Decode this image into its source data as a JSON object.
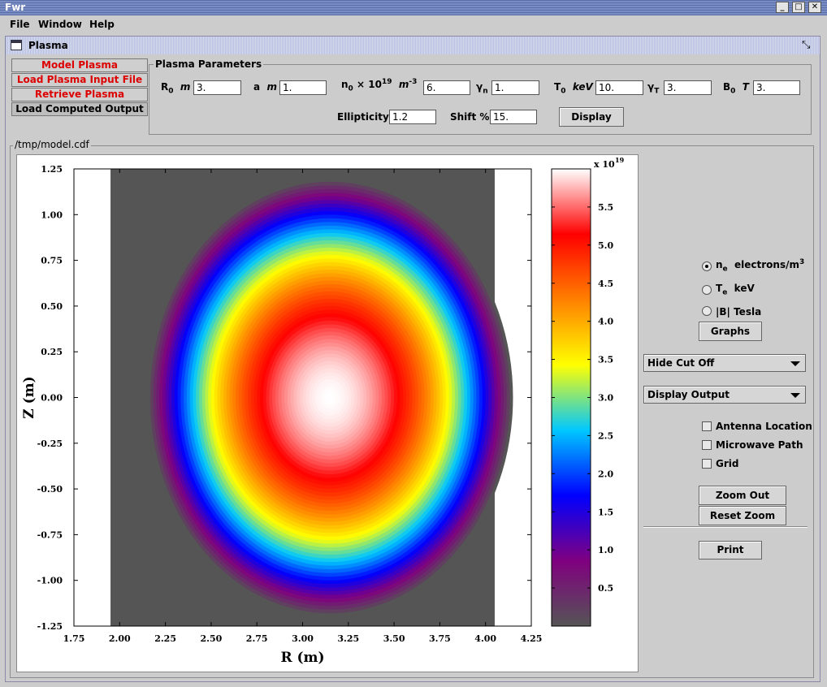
{
  "window": {
    "title": "Fwr",
    "minimize_icon": "minimize-icon",
    "maximize_icon": "maximize-icon",
    "close_icon": "close-icon"
  },
  "menubar": {
    "file": "File",
    "window": "Window",
    "help": "Help"
  },
  "frame": {
    "title": "Plasma",
    "window_icon": "window-icon",
    "restore_icon": "restore-icon"
  },
  "tabs": [
    {
      "label": "Model Plasma"
    },
    {
      "label": "Load Plasma Input File"
    },
    {
      "label": "Retrieve Plasma"
    },
    {
      "label": "Load Computed Output"
    }
  ],
  "params": {
    "group_title": "Plasma Parameters",
    "R0_label": "R",
    "R0_sub": "0",
    "R0_unit": "m",
    "R0_value": "3.",
    "a_label": "a",
    "a_unit": "m",
    "a_value": "1.",
    "n0_label": "n",
    "n0_sub": "0",
    "n0_times": "× 10",
    "n0_exp": "19",
    "n0_unit": "m",
    "n0_unit_exp": "-3",
    "n0_value": "6.",
    "gn_label": "γ",
    "gn_sub": "n",
    "gn_value": "1.",
    "T0_label": "T",
    "T0_sub": "0",
    "T0_unit": "keV",
    "T0_value": "10.",
    "gT_label": "γ",
    "gT_sub": "T",
    "gT_value": "3.",
    "B0_label": "B",
    "B0_sub": "0",
    "B0_unit": "T",
    "B0_value": "3.",
    "ellipticity_label": "Ellipticity",
    "ellipticity_value": "1.2",
    "shift_label": "Shift %",
    "shift_value": "15.",
    "display_button": "Display"
  },
  "output": {
    "group_title": "/tmp/model.cdf"
  },
  "controls": {
    "radio_ne_main": "n",
    "radio_ne_sub": "e",
    "radio_ne_unit": "electrons/m",
    "radio_ne_exp": "3",
    "radio_te_main": "T",
    "radio_te_sub": "e",
    "radio_te_unit": "keV",
    "radio_b_label": "|B|  Tesla",
    "graphs_button": "Graphs",
    "cutoff_combo": "Hide Cut Off",
    "display_combo": "Display Output",
    "antenna_check": "Antenna Location",
    "microwave_check": "Microwave Path",
    "grid_check": "Grid",
    "zoom_out_button": "Zoom Out",
    "reset_zoom_button": "Reset Zoom",
    "print_button": "Print"
  },
  "chart_data": {
    "type": "heatmap",
    "xlabel": "R (m)",
    "ylabel": "Z (m)",
    "xlim": [
      1.75,
      4.25
    ],
    "ylim": [
      -1.25,
      1.25
    ],
    "x_ticks": [
      "1.75",
      "2.00",
      "2.25",
      "2.50",
      "2.75",
      "3.00",
      "3.25",
      "3.50",
      "3.75",
      "4.00",
      "4.25"
    ],
    "y_ticks": [
      "1.25",
      "1.00",
      "0.75",
      "0.50",
      "0.25",
      "0.00",
      "-0.25",
      "-0.50",
      "-0.75",
      "-1.00",
      "-1.25"
    ],
    "data_region_r": [
      1.95,
      4.05
    ],
    "center": {
      "R": 3.15,
      "Z": 0.0
    },
    "minor_radius": 1.0,
    "ellipticity": 1.2,
    "shift_percent": 15,
    "peak_value": 6.0,
    "colorbar": {
      "scale_label": "x 10",
      "scale_exp": "19",
      "range": [
        0,
        6.0
      ],
      "ticks": [
        "5.5",
        "5.0",
        "4.5",
        "4.0",
        "3.5",
        "3.0",
        "2.5",
        "2.0",
        "1.5",
        "1.0",
        "0.5"
      ],
      "colors": [
        "#555555",
        "#800080",
        "#0000ff",
        "#00c8ff",
        "#ffff00",
        "#ff8000",
        "#ff0000",
        "#ffffff"
      ]
    },
    "background_color": "#555555"
  }
}
